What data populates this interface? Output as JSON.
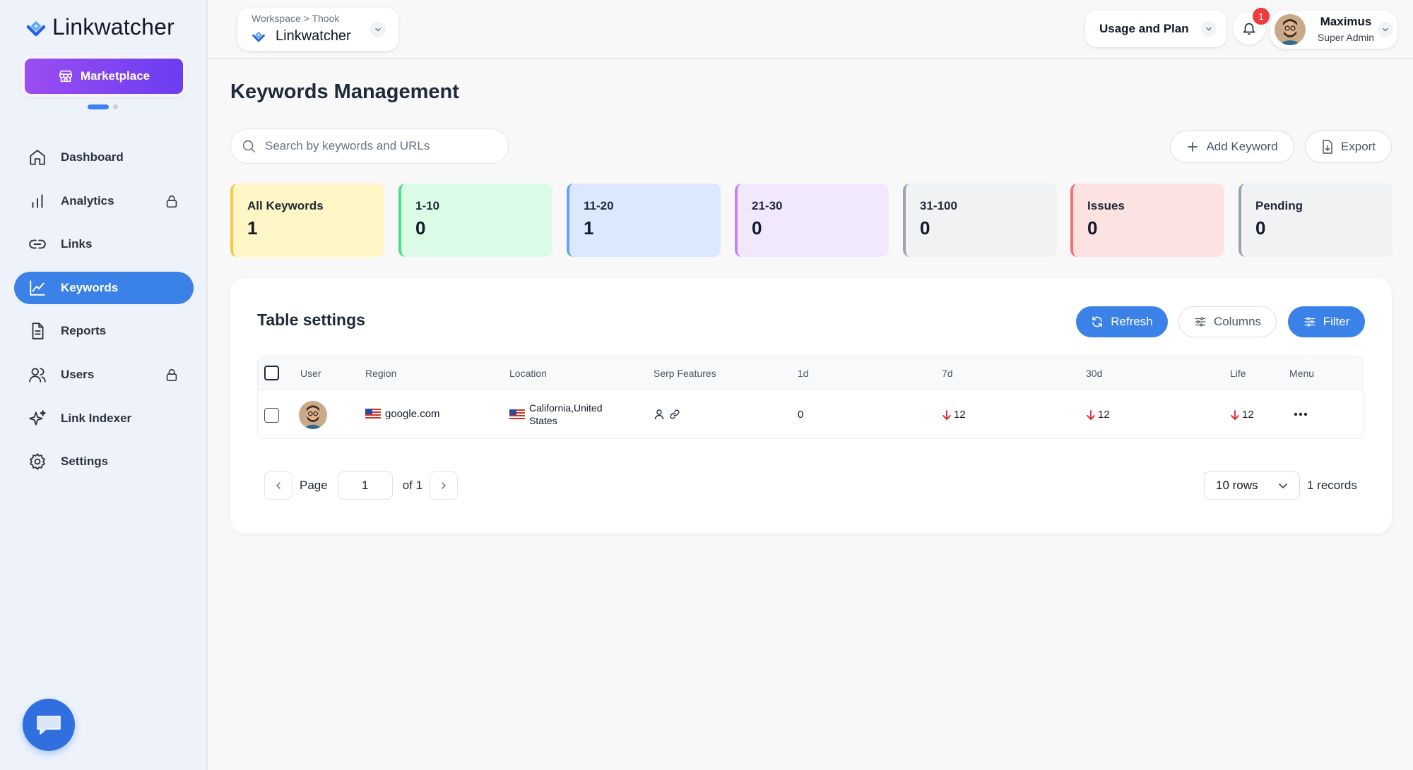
{
  "app": {
    "brand": "Linkwatcher",
    "marketplace_label": "Marketplace"
  },
  "sidebar": {
    "items": [
      {
        "label": "Dashboard",
        "icon": "home-icon",
        "locked": false,
        "active": false
      },
      {
        "label": "Analytics",
        "icon": "bar-chart-icon",
        "locked": true,
        "active": false
      },
      {
        "label": "Links",
        "icon": "link-icon",
        "locked": false,
        "active": false
      },
      {
        "label": "Keywords",
        "icon": "trend-line-icon",
        "locked": false,
        "active": true
      },
      {
        "label": "Reports",
        "icon": "document-icon",
        "locked": false,
        "active": false
      },
      {
        "label": "Users",
        "icon": "users-icon",
        "locked": true,
        "active": false
      },
      {
        "label": "Link Indexer",
        "icon": "sparkle-icon",
        "locked": false,
        "active": false
      },
      {
        "label": "Settings",
        "icon": "gear-icon",
        "locked": false,
        "active": false
      }
    ]
  },
  "header": {
    "workspace_crumb": "Workspace > Thook",
    "workspace_name": "Linkwatcher",
    "usage_label": "Usage and Plan",
    "notification_count": "1",
    "user_name": "Maximus",
    "user_role": "Super Admin"
  },
  "main": {
    "title": "Keywords Management",
    "search_placeholder": "Search by keywords and URLs",
    "add_keyword_label": "Add Keyword",
    "export_label": "Export"
  },
  "stats": [
    {
      "label": "All Keywords",
      "value": "1",
      "bg": "#fef6c4",
      "border": "#f2c94c"
    },
    {
      "label": "1-10",
      "value": "0",
      "bg": "#dcfbe6",
      "border": "#4ade80"
    },
    {
      "label": "11-20",
      "value": "1",
      "bg": "#dbe8fe",
      "border": "#60a5fa"
    },
    {
      "label": "21-30",
      "value": "0",
      "bg": "#f1e8fe",
      "border": "#c084fc"
    },
    {
      "label": "31-100",
      "value": "0",
      "bg": "#f1f2f4",
      "border": "#9ca3af"
    },
    {
      "label": "Issues",
      "value": "0",
      "bg": "#fde2e2",
      "border": "#f87171"
    },
    {
      "label": "Pending",
      "value": "0",
      "bg": "#f1f2f4",
      "border": "#9ca3af"
    }
  ],
  "table": {
    "title": "Table settings",
    "refresh_label": "Refresh",
    "columns_label": "Columns",
    "filter_label": "Filter",
    "headers": [
      "User",
      "Region",
      "Location",
      "Serp Features",
      "1d",
      "7d",
      "30d",
      "Life",
      "Menu"
    ],
    "rows": [
      {
        "region": "google.com",
        "location": "California,United States",
        "d1": "0",
        "d7": "12",
        "d30": "12",
        "life": "12",
        "trend_color": "#e11d2a"
      }
    ]
  },
  "pagination": {
    "page_label": "Page",
    "page_value": "1",
    "of_label": "of 1",
    "rows_label": "10 rows",
    "records_label": "1 records"
  },
  "colors": {
    "accent": "#3b82e8",
    "brand_purple": "#7c3aed"
  }
}
